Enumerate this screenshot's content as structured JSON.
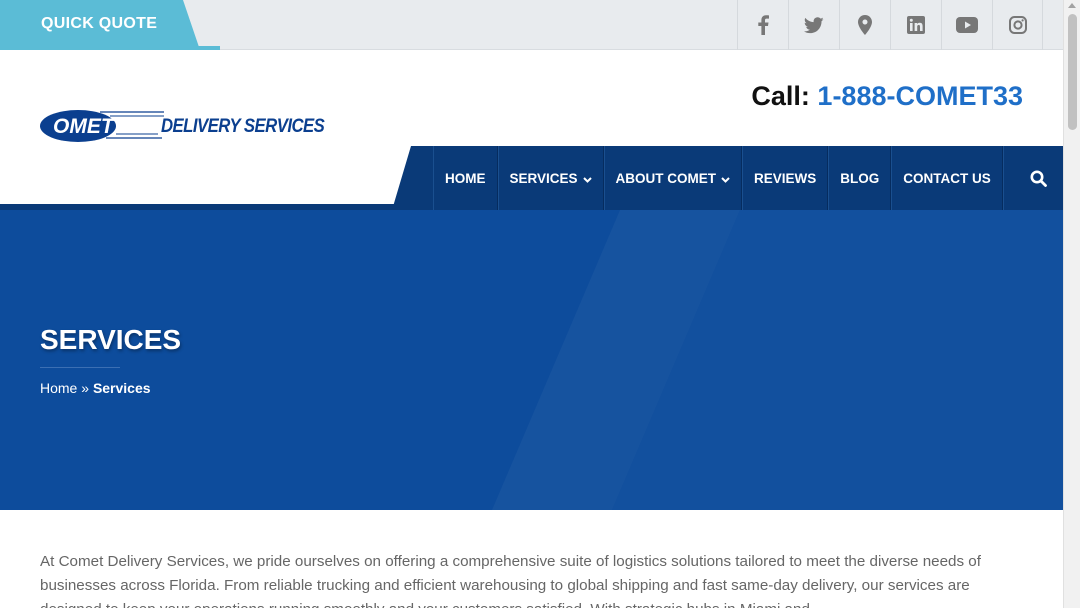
{
  "topbar": {
    "quote_label": "QUICK QUOTE",
    "quote_color": "#5bbcd6",
    "socials": [
      "facebook-icon",
      "twitter-icon",
      "map-pin-icon",
      "linkedin-icon",
      "youtube-icon",
      "instagram-icon"
    ]
  },
  "header": {
    "logo_mark": "OMET",
    "logo_text": "DELIVERY SERVICES",
    "call_label": "Call:",
    "call_number": "1-888-COMET33"
  },
  "nav": {
    "items": [
      {
        "label": "HOME",
        "has_dropdown": false
      },
      {
        "label": "SERVICES",
        "has_dropdown": true
      },
      {
        "label": "ABOUT COMET",
        "has_dropdown": true
      },
      {
        "label": "REVIEWS",
        "has_dropdown": false
      },
      {
        "label": "BLOG",
        "has_dropdown": false
      },
      {
        "label": "CONTACT US",
        "has_dropdown": false
      }
    ],
    "search_icon": "search-icon",
    "bg_color": "#0a3a78"
  },
  "hero": {
    "title": "SERVICES",
    "breadcrumb_home": "Home",
    "breadcrumb_separator": " » ",
    "breadcrumb_current": "Services",
    "bg_color": "#0d4c9c"
  },
  "intro": {
    "text": "At Comet Delivery Services, we pride ourselves on offering a comprehensive suite of logistics solutions tailored to meet the diverse needs of businesses across Florida. From reliable trucking and efficient warehousing to global shipping and fast same-day delivery, our services are designed to keep your operations running smoothly and your customers satisfied. With strategic hubs in Miami and"
  }
}
